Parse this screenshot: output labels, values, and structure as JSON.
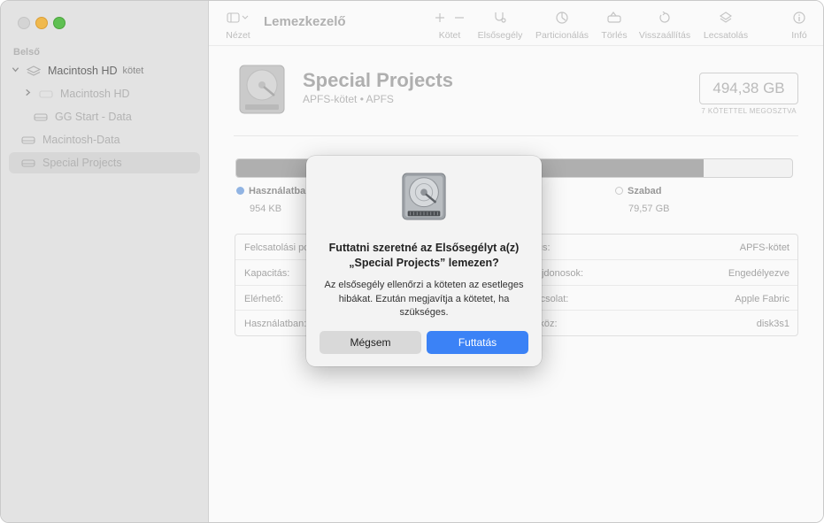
{
  "app": {
    "title": "Lemezkezelő"
  },
  "sidebar": {
    "section": "Belső",
    "items": [
      {
        "label": "Macintosh HD",
        "tag": "kötet"
      },
      {
        "label": "Macintosh HD"
      },
      {
        "label": "GG Start - Data"
      },
      {
        "label": "Macintosh-Data"
      },
      {
        "label": "Special Projects"
      }
    ]
  },
  "toolbar": {
    "view": "Nézet",
    "volume": "Kötet",
    "firstaid": "Elsősegély",
    "partition": "Particionálás",
    "erase": "Törlés",
    "restore": "Visszaállítás",
    "unmount": "Lecsatolás",
    "info": "Infó"
  },
  "volume": {
    "name": "Special Projects",
    "subtitle": "APFS-kötet • APFS",
    "capacity": "494,38 GB",
    "shared_note": "7 KÖTETTEL MEGOSZTVA",
    "used_fraction": 0.84
  },
  "legend": {
    "used_label": "Használatban",
    "used_value": "954 KB",
    "free_label": "Szabad",
    "free_value": "79,57 GB"
  },
  "info": {
    "rows": [
      {
        "k1": "Felcsatolási pont:",
        "k2": "Típus:",
        "v2": "APFS-kötet"
      },
      {
        "k1": "Kapacitás:",
        "k2": "Tulajdonosok:",
        "v2": "Engedélyezve"
      },
      {
        "k1": "Elérhető:",
        "k2": "Kapcsolat:",
        "v2": "Apple Fabric"
      },
      {
        "k1": "Használatban:",
        "k2": "Eszköz:",
        "v2": "disk3s1"
      }
    ]
  },
  "dialog": {
    "title_line1": "Futtatni szeretné az Elsősegélyt a(z)",
    "title_line2": "„Special Projects” lemezen?",
    "body": "Az elsősegély ellenőrzi a köteten az esetleges hibákat. Ezután megjavítja a kötetet, ha szükséges.",
    "cancel": "Mégsem",
    "run": "Futtatás"
  },
  "colors": {
    "accent": "#3b82f6",
    "used": "#b3b3b3"
  },
  "icons": [
    "disk-icon",
    "hard-drive-icon",
    "stack-icon",
    "sidebar-toggle-icon",
    "plus-icon",
    "minus-icon",
    "stethoscope-icon",
    "pie-icon",
    "erase-icon",
    "restore-icon",
    "eject-icon",
    "info-icon"
  ]
}
